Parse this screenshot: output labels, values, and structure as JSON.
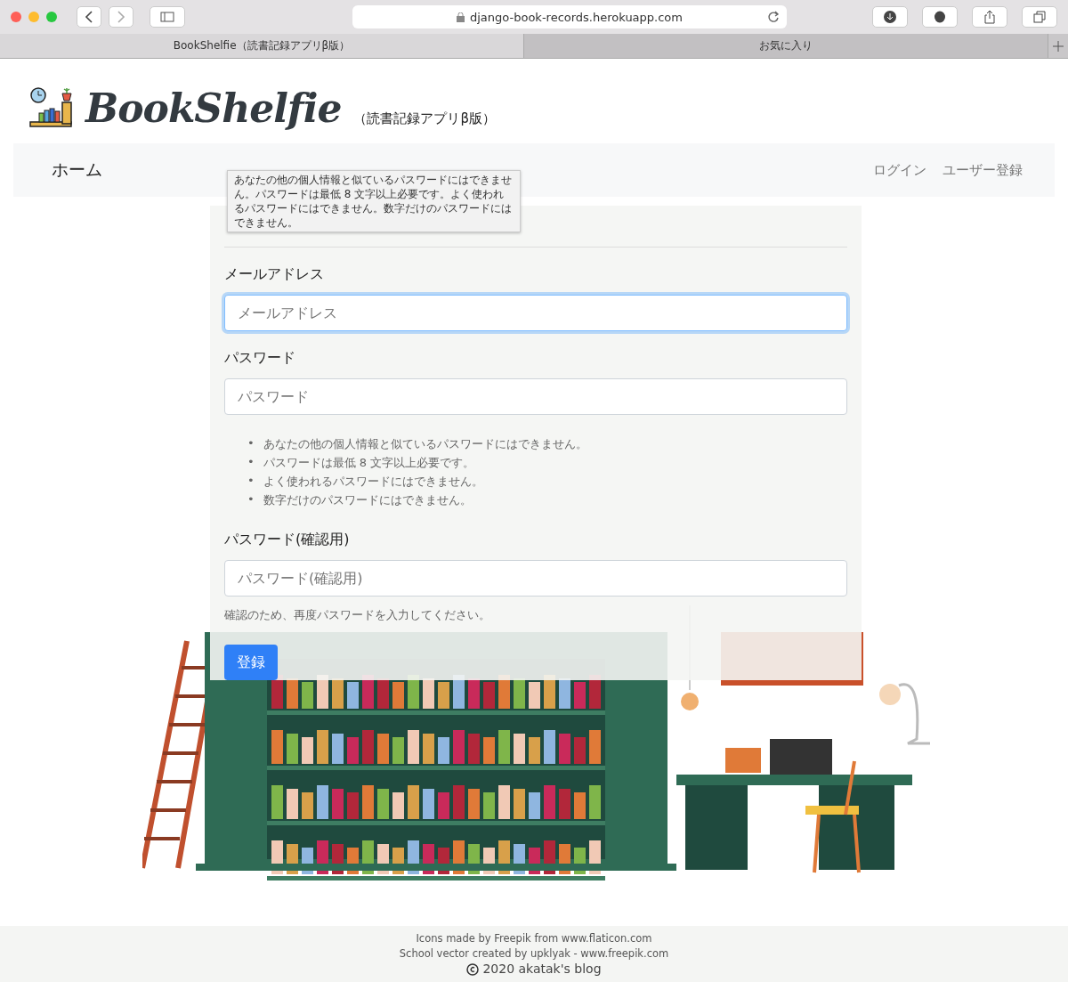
{
  "browser": {
    "url": "django-book-records.herokuapp.com",
    "tabs": [
      {
        "label": "BookShelfie（読書記録アプリβ版）",
        "selected": true
      },
      {
        "label": "お気に入り",
        "selected": false
      }
    ]
  },
  "header": {
    "logo": "BookShelfie",
    "subtitle": "（読書記録アプリβ版）"
  },
  "nav": {
    "home": "ホーム",
    "links": [
      "ログイン",
      "ユーザー登録"
    ]
  },
  "tooltip": "あなたの他の個人情報と似ているパスワードにはできません。パスワードは最低 8 文字以上必要です。よく使われるパスワードにはできません。数字だけのパスワードにはできません。",
  "form": {
    "fields": [
      {
        "label": "メールアドレス",
        "placeholder": "メールアドレス",
        "focused": true
      },
      {
        "label": "パスワード",
        "placeholder": "パスワード",
        "focused": false,
        "help_list": [
          {
            "bullet": "•",
            "text": "あなたの他の個人情報と似ているパスワードにはできません。"
          },
          {
            "bullet": "•",
            "text": "パスワードは最低 8 文字以上必要です。"
          },
          {
            "bullet": "•",
            "text": "よく使われるパスワードにはできません。"
          },
          {
            "bullet": "•",
            "text": "数字だけのパスワードにはできません。"
          }
        ]
      },
      {
        "label": "パスワード(確認用)",
        "placeholder": "パスワード(確認用)",
        "focused": false,
        "help": "確認のため、再度パスワードを入力してください。"
      }
    ],
    "submit": "登録"
  },
  "footer": {
    "credits": [
      "Icons made by Freepik from www.flaticon.com",
      "School vector created by upklyak - www.freepik.com"
    ],
    "copyright": "2020 akatak's blog"
  }
}
